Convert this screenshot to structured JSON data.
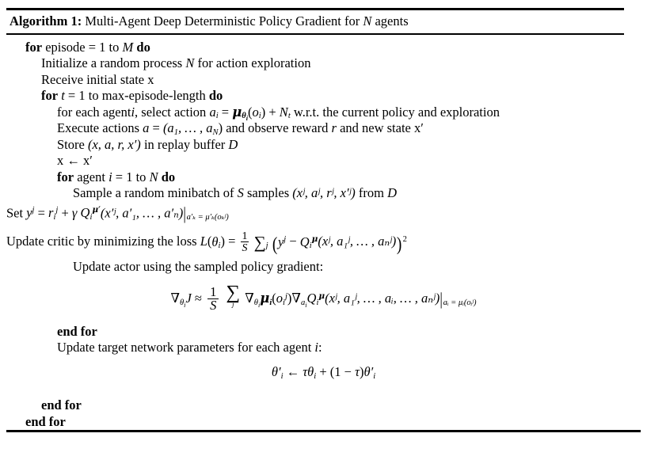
{
  "algorithm": {
    "label": "Algorithm 1:",
    "title": "Multi-Agent Deep Deterministic Policy Gradient for N agents",
    "title_math_var": "N",
    "title_text_before": "Multi-Agent Deep Deterministic Policy Gradient for",
    "title_text_after": "agents"
  },
  "lines": {
    "for_episode": {
      "kw_for": "for",
      "text_episode": "episode",
      "eq": "=",
      "one": "1",
      "to": "to",
      "var_M": "M",
      "kw_do": "do"
    },
    "initialize": {
      "text_before": "Initialize a random process",
      "var_N": "N",
      "text_after": "for action exploration"
    },
    "receive": {
      "text": "Receive initial state",
      "var_x": "x"
    },
    "for_t": {
      "kw_for": "for",
      "var_t": "t",
      "eq": "=",
      "one": "1",
      "to": "to",
      "bound": "max-episode-length",
      "kw_do": "do"
    },
    "select_action": {
      "text_before": "for each agent",
      "var_i": "i",
      "text_mid": ", select action",
      "var_a": "a",
      "sub_i": "i",
      "eq": "=",
      "mu": "μ",
      "mu_sub_theta": "θ",
      "mu_sub_theta_sub": "i",
      "arg_o": "o",
      "arg_o_sub": "i",
      "plus": "+",
      "cal_N": "N",
      "cal_N_sub": "t",
      "text_after": "w.r.t. the current policy and exploration"
    },
    "execute": {
      "text_before": "Execute actions",
      "var_a": "a",
      "eq": "=",
      "list": "(a",
      "sub_1": "1",
      "dots": ", … , a",
      "sub_N": "N",
      "close": ")",
      "text_mid": "and observe reward",
      "var_r": "r",
      "text_after": "and new state",
      "var_xprime": "x′"
    },
    "store": {
      "text_before": "Store",
      "tuple": "(x, a, r, x′)",
      "text_mid": "in replay buffer",
      "cal_D": "D"
    },
    "assign_x": {
      "lhs": "x",
      "arrow": "←",
      "rhs": "x′"
    },
    "for_agent": {
      "kw_for": "for",
      "text_agent": "agent",
      "var_i": "i",
      "eq": "=",
      "one": "1",
      "to": "to",
      "var_N": "N",
      "kw_do": "do"
    },
    "sample": {
      "text_before": "Sample a random minibatch of",
      "var_S": "S",
      "text_mid": "samples",
      "tuple": "(xʲ, aʲ, rʲ, x′ʲ)",
      "text_after": "from",
      "cal_D": "D"
    },
    "set_y": {
      "text_set": "Set",
      "var_y": "y",
      "sup_j": "j",
      "eq": "=",
      "var_r": "r",
      "sub_i": "i",
      "sup_j2": "j",
      "plus": "+",
      "gamma": "γ",
      "var_Q": "Q",
      "Q_sub_i": "i",
      "Q_sup_mu": "μ′",
      "args": "(x′ʲ, a′₁, … , a′ₙ)",
      "eval_bar": "|",
      "eval_cond": "a′ₖ = μ′ₖ(oₖʲ)"
    },
    "update_critic": {
      "text_before": "Update critic by minimizing the loss",
      "cal_L": "L",
      "theta_i": "θ",
      "sub_i": "i",
      "eq": "=",
      "frac_num": "1",
      "frac_den": "S",
      "sum": "∑",
      "sum_sub": "j",
      "y_j": "y",
      "y_sup": "j",
      "minus": "−",
      "Q": "Q",
      "Q_sub": "i",
      "Q_sup": "μ",
      "args": "(xʲ, a₁ʲ, … , aₙʲ)",
      "power": "2"
    },
    "update_actor": {
      "text": "Update actor using the sampled policy gradient:"
    },
    "gradient_eq": {
      "nabla": "∇",
      "theta": "θ",
      "theta_sub": "i",
      "J": "J",
      "approx": "≈",
      "frac_num": "1",
      "frac_den": "S",
      "sum": "∑",
      "sum_sub": "j",
      "mu": "μ",
      "mu_sub": "i",
      "o_arg": "o",
      "o_sub": "i",
      "o_sup": "j",
      "nabla_a": "a",
      "nabla_a_sub": "i",
      "Q": "Q",
      "Q_sub": "i",
      "Q_sup": "μ",
      "args": "(xʲ, a₁ʲ, … , aᵢ, … , aₙʲ)",
      "eval_bar": "|",
      "eval_cond": "aᵢ = μᵢ(oᵢʲ)"
    },
    "end_for_inner": {
      "kw": "end for"
    },
    "update_target": {
      "text_before": "Update target network parameters for each agent",
      "var_i": "i",
      "colon": ":"
    },
    "target_eq": {
      "theta_prime": "θ′",
      "sub_i": "i",
      "arrow": "←",
      "tau": "τ",
      "theta": "θ",
      "theta_sub": "i",
      "plus": "+",
      "open": "(1",
      "minus": "−",
      "tau2": "τ",
      "close": ")",
      "theta_prime2": "θ′",
      "sub_i2": "i"
    },
    "end_for_mid": {
      "kw": "end for"
    },
    "end_for_outer": {
      "kw": "end for"
    }
  },
  "colors": {
    "text": "#000000",
    "rule": "#000000",
    "background": "#ffffff"
  }
}
